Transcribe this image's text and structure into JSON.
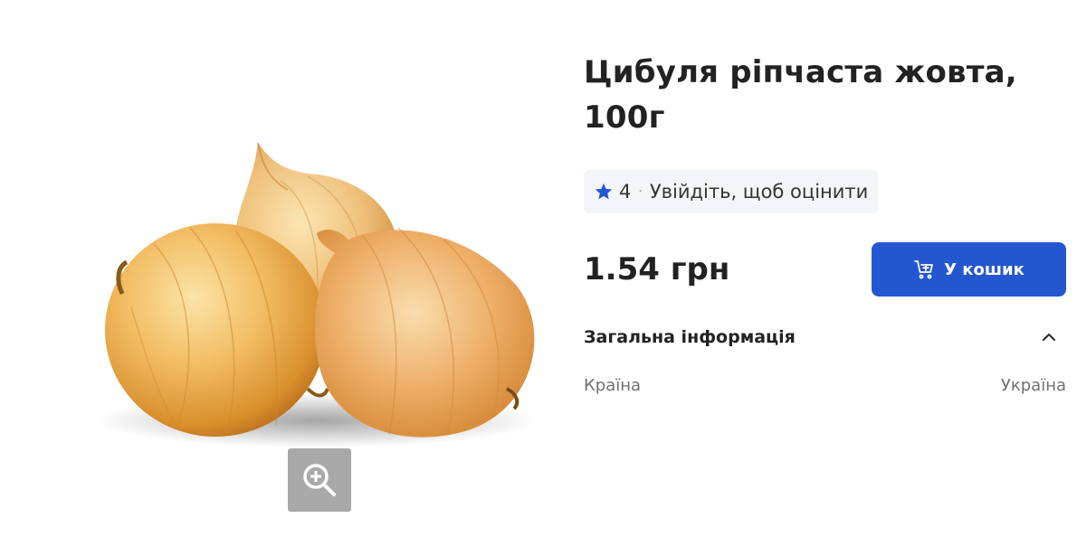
{
  "product": {
    "title": "Цибуля ріпчаста жовта, 100г",
    "rating_value": "4",
    "rating_separator": "·",
    "rating_cta": "Увійдіть, щоб оцінити",
    "price": "1.54 грн",
    "add_to_cart_label": "У кошик",
    "image_alt": "onions"
  },
  "general_info": {
    "title": "Загальна інформація",
    "expanded": true,
    "rows": [
      {
        "label": "Країна",
        "value": "Україна"
      }
    ]
  },
  "icons": {
    "star": "star-icon",
    "cart": "cart-plus-icon",
    "zoom": "zoom-in-icon",
    "chevron": "chevron-up-icon"
  },
  "colors": {
    "accent": "#2456d0",
    "zoom_bg": "#a9a9a9",
    "rating_bg": "#f3f5f9",
    "muted_text": "#6f6f6f"
  }
}
